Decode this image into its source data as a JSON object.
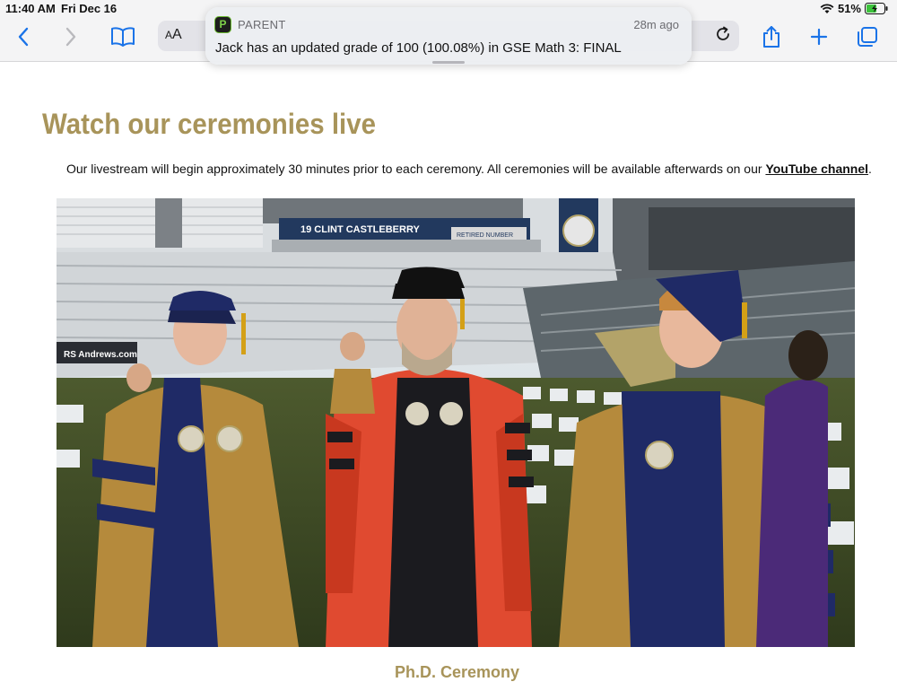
{
  "status_bar": {
    "time": "11:40 AM",
    "date": "Fri Dec 16",
    "battery": "51%"
  },
  "toolbar": {
    "text_size_label_small": "A",
    "text_size_label_large": "A"
  },
  "notification": {
    "app_name": "PARENT",
    "app_icon_letter": "P",
    "time_ago": "28m ago",
    "message": "Jack has an updated grade of 100 (100.08%) in GSE Math 3: FINAL"
  },
  "page": {
    "title": "Watch our ceremonies live",
    "intro_text": "Our livestream will begin approximately 30 minutes prior to each ceremony. All ceremonies will be available afterwards on our ",
    "intro_link": "YouTube channel",
    "intro_end": ".",
    "video_banner_text": "19   CLINT CASTLEBERRY",
    "video_banner_sub": "RETIRED NUMBER",
    "video_sponsor_text": "RS Andrews.com",
    "next_heading": "Ph.D. Ceremony"
  },
  "colors": {
    "title_gold": "#a8945a",
    "safari_blue": "#1a73e8"
  }
}
